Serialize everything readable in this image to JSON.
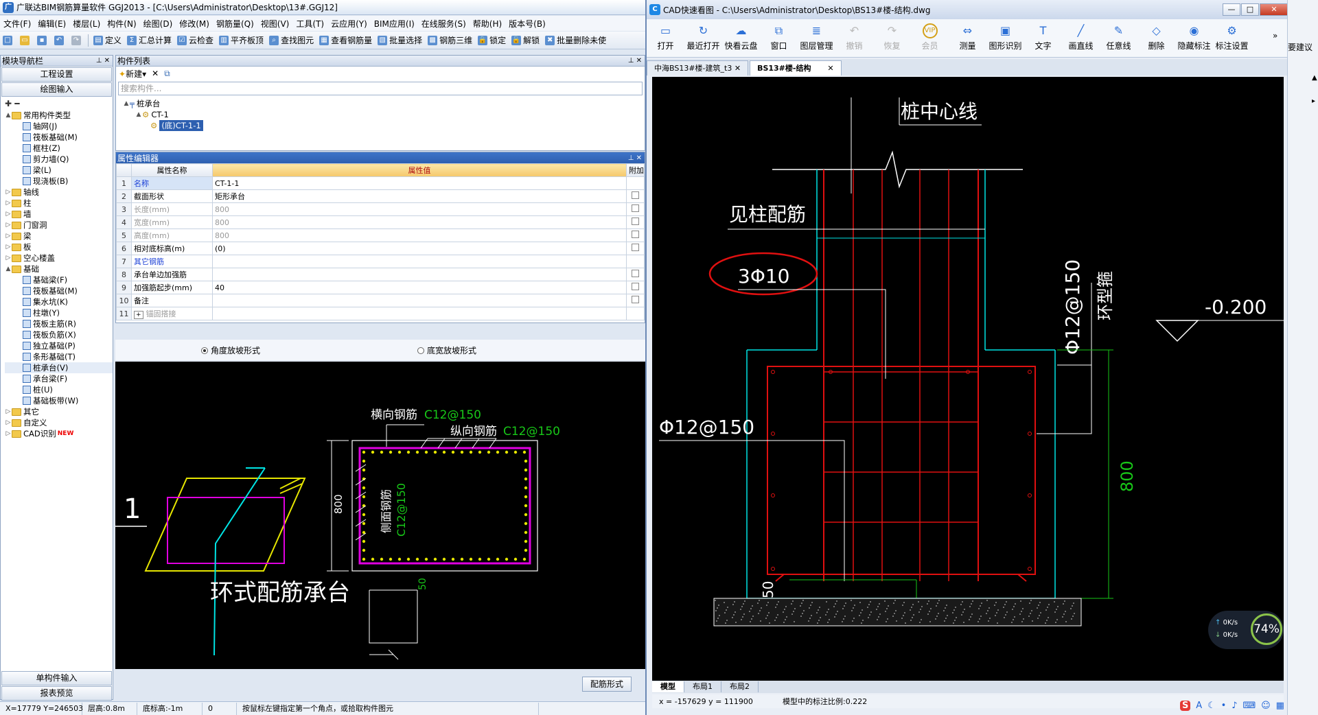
{
  "ggj": {
    "title": "广联达BIM钢筋算量软件 GGJ2013 - [C:\\Users\\Administrator\\Desktop\\13#.GGJ12]",
    "menu": [
      "文件(F)",
      "编辑(E)",
      "楼层(L)",
      "构件(N)",
      "绘图(D)",
      "修改(M)",
      "钢筋量(Q)",
      "视图(V)",
      "工具(T)",
      "云应用(Y)",
      "BIM应用(I)",
      "在线服务(S)",
      "帮助(H)",
      "版本号(B)"
    ],
    "toolbar": [
      "定义",
      "汇总计算",
      "云检查",
      "平齐板顶",
      "查找图元",
      "查看钢筋量",
      "批量选择",
      "钢筋三维",
      "锁定",
      "解锁",
      "批量删除未使"
    ],
    "nav": {
      "title": "模块导航栏",
      "btn_project": "工程设置",
      "btn_draw": "绘图输入",
      "btn_single": "单构件输入",
      "btn_report": "报表预览",
      "tree": [
        {
          "level": 0,
          "type": "folder",
          "label": "常用构件类型",
          "exp": "▲"
        },
        {
          "level": 1,
          "type": "item",
          "label": "轴网(J)"
        },
        {
          "level": 1,
          "type": "item",
          "label": "筏板基础(M)"
        },
        {
          "level": 1,
          "type": "item",
          "label": "框柱(Z)"
        },
        {
          "level": 1,
          "type": "item",
          "label": "剪力墙(Q)"
        },
        {
          "level": 1,
          "type": "item",
          "label": "梁(L)"
        },
        {
          "level": 1,
          "type": "item",
          "label": "现浇板(B)"
        },
        {
          "level": 0,
          "type": "folder",
          "label": "轴线",
          "exp": "▷"
        },
        {
          "level": 0,
          "type": "folder",
          "label": "柱",
          "exp": "▷"
        },
        {
          "level": 0,
          "type": "folder",
          "label": "墙",
          "exp": "▷"
        },
        {
          "level": 0,
          "type": "folder",
          "label": "门窗洞",
          "exp": "▷"
        },
        {
          "level": 0,
          "type": "folder",
          "label": "梁",
          "exp": "▷"
        },
        {
          "level": 0,
          "type": "folder",
          "label": "板",
          "exp": "▷"
        },
        {
          "level": 0,
          "type": "folder",
          "label": "空心楼盖",
          "exp": "▷"
        },
        {
          "level": 0,
          "type": "folder",
          "label": "基础",
          "exp": "▲"
        },
        {
          "level": 1,
          "type": "item",
          "label": "基础梁(F)"
        },
        {
          "level": 1,
          "type": "item",
          "label": "筏板基础(M)"
        },
        {
          "level": 1,
          "type": "item",
          "label": "集水坑(K)"
        },
        {
          "level": 1,
          "type": "item",
          "label": "柱墩(Y)"
        },
        {
          "level": 1,
          "type": "item",
          "label": "筏板主筋(R)"
        },
        {
          "level": 1,
          "type": "item",
          "label": "筏板负筋(X)"
        },
        {
          "level": 1,
          "type": "item",
          "label": "独立基础(P)"
        },
        {
          "level": 1,
          "type": "item",
          "label": "条形基础(T)"
        },
        {
          "level": 1,
          "type": "item",
          "label": "桩承台(V)"
        },
        {
          "level": 1,
          "type": "item",
          "label": "承台梁(F)"
        },
        {
          "level": 1,
          "type": "item",
          "label": "桩(U)"
        },
        {
          "level": 1,
          "type": "item",
          "label": "基础板带(W)"
        },
        {
          "level": 0,
          "type": "folder",
          "label": "其它",
          "exp": "▷"
        },
        {
          "level": 0,
          "type": "folder",
          "label": "自定义",
          "exp": "▷"
        },
        {
          "level": 0,
          "type": "folder",
          "label": "CAD识别",
          "exp": "▷",
          "badge": "NEW"
        }
      ]
    },
    "clist": {
      "title": "构件列表",
      "new_label": "新建",
      "search_placeholder": "搜索构件...",
      "tree": [
        "桩承台",
        "CT-1",
        "(底)CT-1-1"
      ]
    },
    "props": {
      "title": "属性编辑器",
      "col_name": "属性名称",
      "col_value": "属性值",
      "col_extra": "附加",
      "rows": [
        {
          "n": "1",
          "name": "名称",
          "value": "CT-1-1",
          "style": "blue",
          "chk": false
        },
        {
          "n": "2",
          "name": "截面形状",
          "value": "矩形承台",
          "style": "",
          "chk": true
        },
        {
          "n": "3",
          "name": "长度(mm)",
          "value": "800",
          "style": "gray",
          "chk": true
        },
        {
          "n": "4",
          "name": "宽度(mm)",
          "value": "800",
          "style": "gray",
          "chk": true
        },
        {
          "n": "5",
          "name": "高度(mm)",
          "value": "800",
          "style": "gray",
          "chk": true
        },
        {
          "n": "6",
          "name": "相对底标高(m)",
          "value": "(0)",
          "style": "",
          "chk": true
        },
        {
          "n": "7",
          "name": "其它钢筋",
          "value": "",
          "style": "blue",
          "chk": false
        },
        {
          "n": "8",
          "name": "承台单边加强筋",
          "value": "",
          "style": "",
          "chk": true
        },
        {
          "n": "9",
          "name": "加强筋起步(mm)",
          "value": "40",
          "style": "",
          "chk": true
        },
        {
          "n": "10",
          "name": "备注",
          "value": "",
          "style": "",
          "chk": true
        },
        {
          "n": "11",
          "name": "锚固搭接",
          "value": "",
          "style": "gray",
          "chk": false,
          "plus": "+"
        }
      ]
    },
    "radio_a": "角度放坡形式",
    "radio_b": "底宽放坡形式",
    "canvas": {
      "label1": "横向钢筋",
      "spec1": "C12@150",
      "label2": "纵向钢筋",
      "spec2": "C12@150",
      "side_label": "侧面钢筋",
      "side_spec": "C12@150",
      "dim800": "800",
      "dim50": "50",
      "num1": "1",
      "caption": "环式配筋承台"
    },
    "peijin_btn": "配筋形式",
    "status": [
      "X=17779 Y=246503",
      "层高:0.8m",
      "底标高:-1m",
      "0",
      "按鼠标左键指定第一个角点，或拾取构件图元"
    ]
  },
  "cad": {
    "title": "CAD快速看图 - C:\\Users\\Administrator\\Desktop\\BS13#楼-结构.dwg",
    "tools": [
      {
        "label": "打开",
        "icon": "▭",
        "dis": false
      },
      {
        "label": "最近打开",
        "icon": "↻",
        "dis": false
      },
      {
        "label": "快看云盘",
        "icon": "☁",
        "dis": false
      },
      {
        "label": "窗口",
        "icon": "⧉",
        "dis": false
      },
      {
        "label": "图层管理",
        "icon": "≣",
        "dis": false
      },
      {
        "label": "撤销",
        "icon": "↶",
        "dis": true
      },
      {
        "label": "恢复",
        "icon": "↷",
        "dis": true
      },
      {
        "label": "会员",
        "icon": "VIP",
        "dis": true
      },
      {
        "label": "测量",
        "icon": "⇔",
        "dis": false
      },
      {
        "label": "图形识别",
        "icon": "▣",
        "dis": false
      },
      {
        "label": "文字",
        "icon": "T",
        "dis": false
      },
      {
        "label": "画直线",
        "icon": "╱",
        "dis": false
      },
      {
        "label": "任意线",
        "icon": "✎",
        "dis": false
      },
      {
        "label": "删除",
        "icon": "◇",
        "dis": false
      },
      {
        "label": "隐藏标注",
        "icon": "◉",
        "dis": false
      },
      {
        "label": "标注设置",
        "icon": "⚙",
        "dis": false
      }
    ],
    "tab1": "中海BS13#楼-建筑_t3",
    "tab2": "BS13#楼-结构",
    "drawing": {
      "pile_center": "桩中心线",
      "see_pile": "见柱配筋",
      "bar_count": "3Φ10",
      "hoop_spec": "Φ12@150",
      "hoop_label": "环型箍",
      "elev": "-0.200",
      "left_spec": "Φ12@150",
      "dim800": "800",
      "dim50": "50"
    },
    "layout_tabs": [
      "模型",
      "布局1",
      "布局2"
    ],
    "coords": "x = -157629  y = 111900",
    "scale": "模型中的标注比例:0.222"
  },
  "side": {
    "suggest": "要建议"
  },
  "speed": {
    "up": "0K/s",
    "down": "0K/s",
    "pct": "74%"
  },
  "colors": {
    "cyan": "#00e5e5",
    "red": "#e01010",
    "green": "#18c818",
    "magenta": "#e000e0",
    "yellow": "#e6e600"
  }
}
